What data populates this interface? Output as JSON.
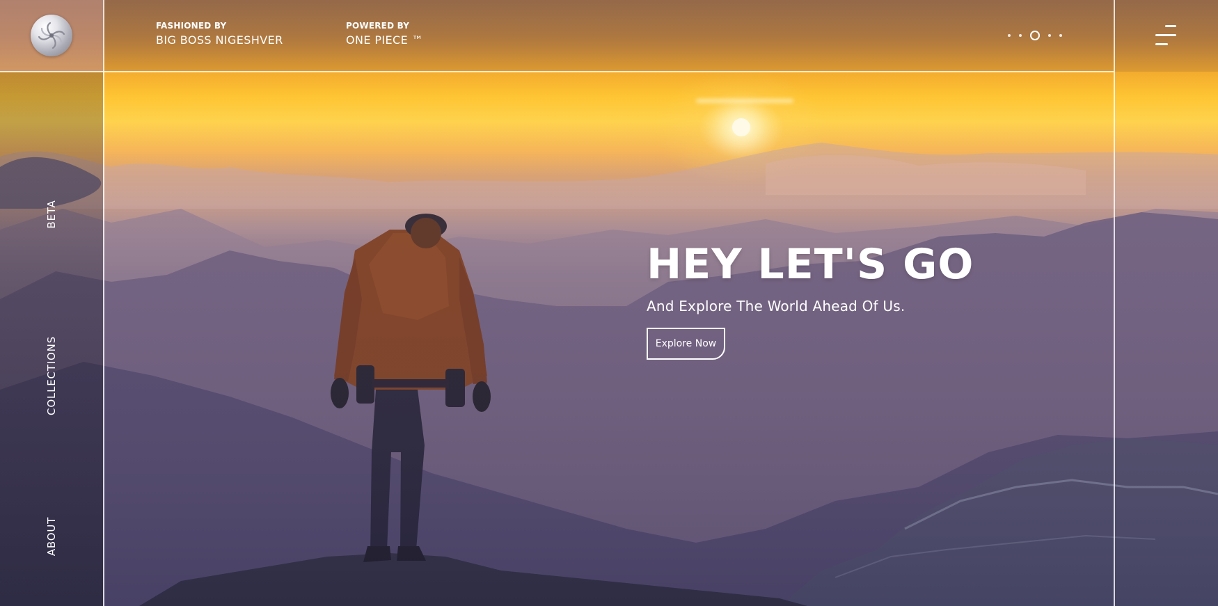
{
  "header": {
    "credit_1": {
      "label": "FASHIONED BY",
      "value": "BIG BOSS NIGESHVER"
    },
    "credit_2": {
      "label": "POWERED BY",
      "value": "ONE PIECE ™"
    },
    "slider": {
      "dot_count": 5,
      "active_index": 2
    }
  },
  "sidebar": {
    "items": [
      {
        "label": "BETA"
      },
      {
        "label": "COLLECTIONS"
      },
      {
        "label": "ABOUT"
      }
    ]
  },
  "hero": {
    "title": "HEY LET'S GO",
    "subtitle": "And Explore The World Ahead Of Us.",
    "cta_label": "Explore Now",
    "background_description": "hiker silhouette on mountain ridge at sunset"
  },
  "colors": {
    "sky_top": "#b8824e",
    "sky_glow": "#ffc42e",
    "mountain_shadow": "#3f3c5c",
    "line": "#ffffff",
    "text": "#ffffff"
  },
  "icons": {
    "logo": "shell-swirl-logo-icon",
    "menu": "hamburger-menu-icon"
  }
}
